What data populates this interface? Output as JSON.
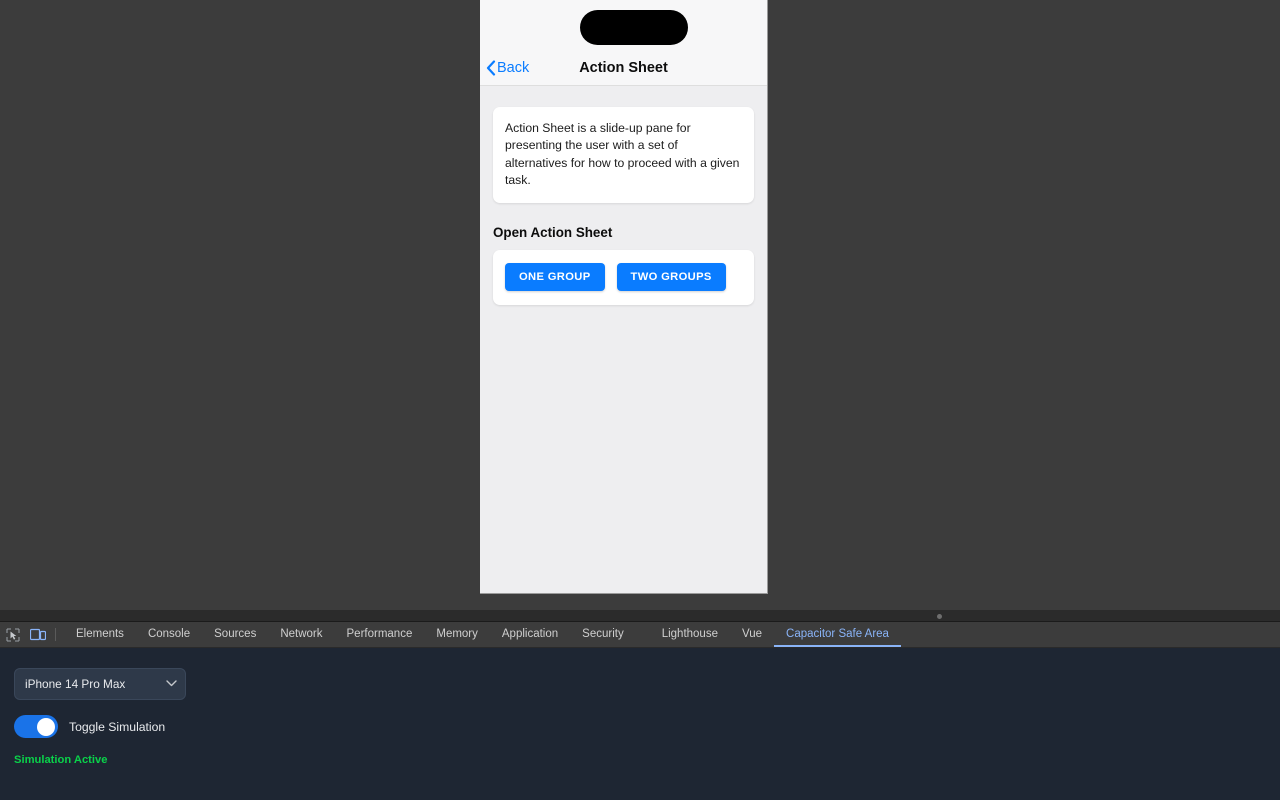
{
  "device_preview": {
    "status_bar": {
      "dynamic_island": "dynamic-island"
    },
    "navbar": {
      "back_label": "Back",
      "back_icon": "chevron-left-icon",
      "title": "Action Sheet"
    },
    "description_card": {
      "text": "Action Sheet is a slide-up pane for presenting the user with a set of alternatives for how to proceed with a given task."
    },
    "section_heading": "Open Action Sheet",
    "buttons": [
      {
        "label": "ONE GROUP",
        "name": "one-group-button"
      },
      {
        "label": "TWO GROUPS",
        "name": "two-groups-button"
      }
    ]
  },
  "devtools": {
    "icons": {
      "inspect": "inspect-element-icon",
      "device_toolbar": "device-toolbar-icon",
      "drag_handle": "drag-handle-icon"
    },
    "tabs": [
      {
        "label": "Elements",
        "active": false
      },
      {
        "label": "Console",
        "active": false
      },
      {
        "label": "Sources",
        "active": false
      },
      {
        "label": "Network",
        "active": false
      },
      {
        "label": "Performance",
        "active": false
      },
      {
        "label": "Memory",
        "active": false
      },
      {
        "label": "Application",
        "active": false
      },
      {
        "label": "Security",
        "active": false
      },
      {
        "label": "Lighthouse",
        "active": false
      },
      {
        "label": "Vue",
        "active": false
      },
      {
        "label": "Capacitor Safe Area",
        "active": true
      }
    ],
    "panel": {
      "device_select": {
        "value": "iPhone 14 Pro Max",
        "options": [
          "iPhone 14 Pro Max"
        ],
        "chevron_icon": "chevron-down-icon"
      },
      "toggle": {
        "label": "Toggle Simulation",
        "on": true
      },
      "status_text": "Simulation Active",
      "status_color": "#0ad14a"
    }
  }
}
